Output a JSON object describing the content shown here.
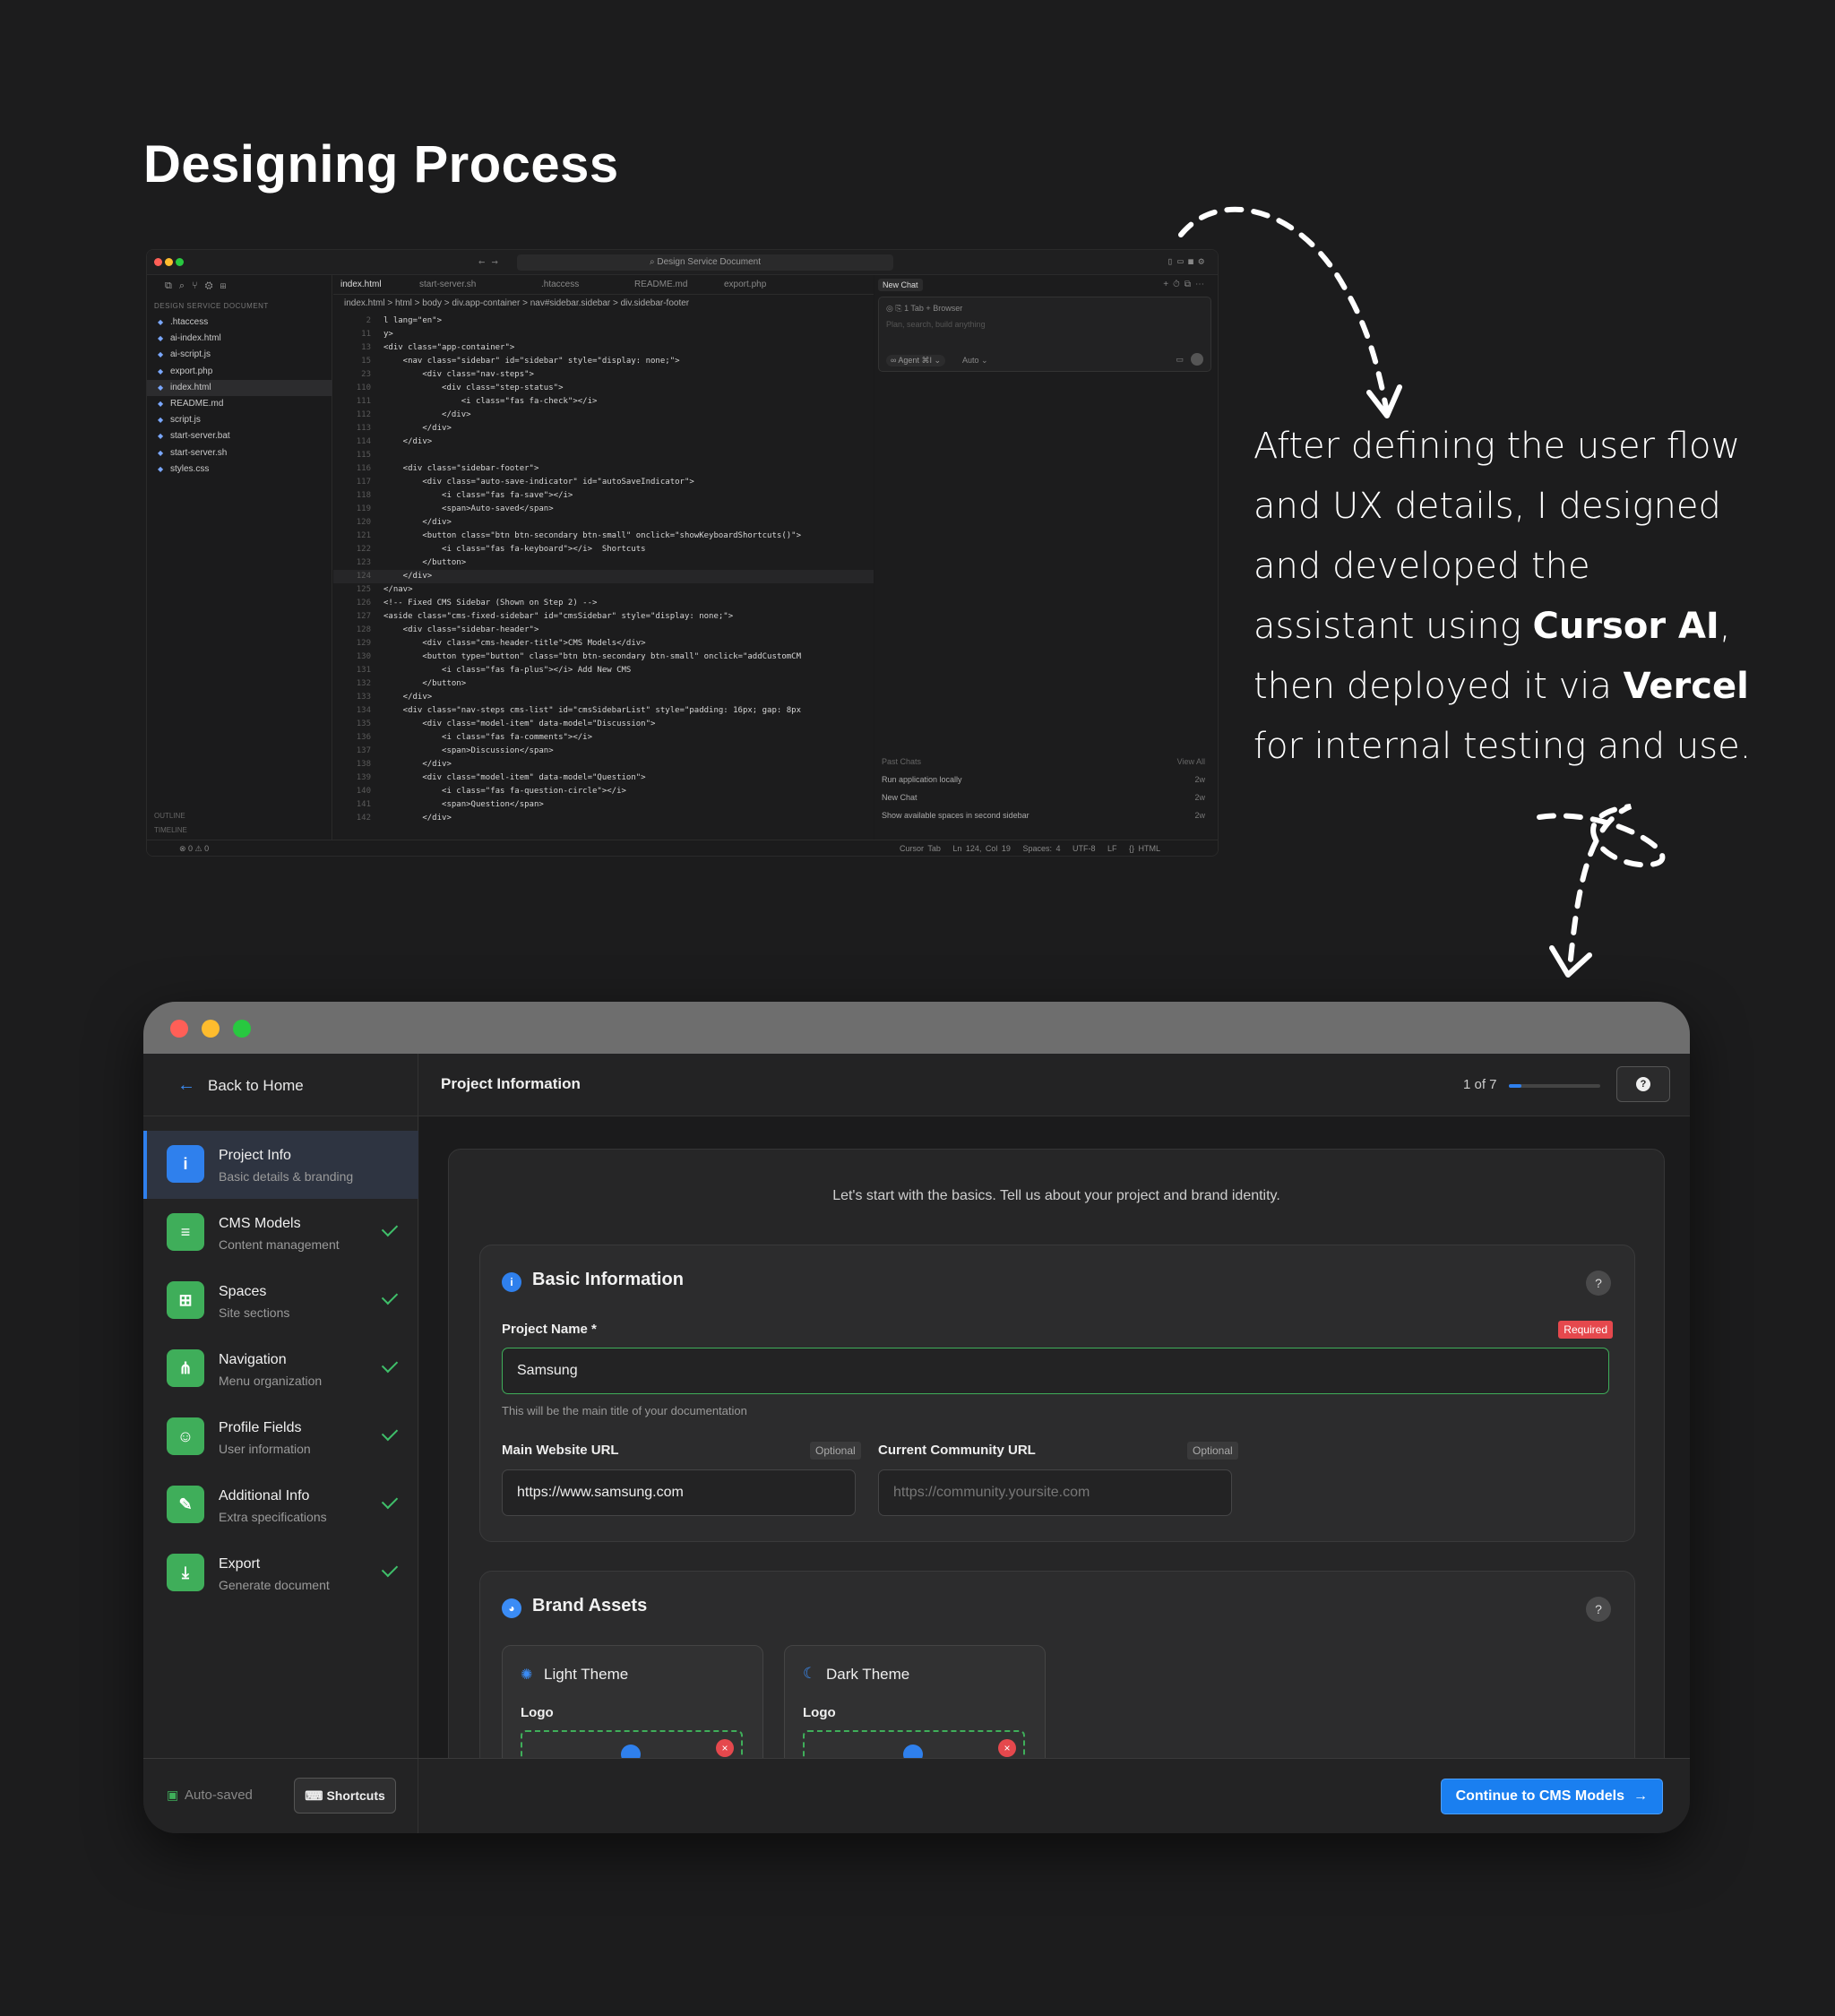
{
  "page": {
    "title": "Designing Process"
  },
  "ide": {
    "search_title": "Design Service Document",
    "explorer_header": "DESIGN SERVICE DOCUMENT",
    "files": [
      ".htaccess",
      "ai-index.html",
      "ai-script.js",
      "export.php",
      "index.html",
      "README.md",
      "script.js",
      "start-server.bat",
      "start-server.sh",
      "styles.css"
    ],
    "outline": "OUTLINE",
    "timeline": "TIMELINE",
    "tabs": [
      "index.html",
      "start-server.sh",
      ".htaccess",
      "README.md",
      "export.php"
    ],
    "breadcrumb": "index.html > html > body > div.app-container > nav#sidebar.sidebar > div.sidebar-footer",
    "line_numbers": [
      "2",
      "11",
      "13",
      "15",
      "23",
      "110",
      "111",
      "112",
      "113",
      "114",
      "115",
      "116",
      "117",
      "118",
      "119",
      "120",
      "121",
      "122",
      "123",
      "124",
      "125",
      "126",
      "127",
      "128",
      "129",
      "130",
      "131",
      "132",
      "133",
      "134",
      "135",
      "136",
      "137",
      "138",
      "139",
      "140",
      "141",
      "142"
    ],
    "code_lines": [
      "l lang=\"en\">",
      "y>",
      "<div class=\"app-container\">",
      "    <nav class=\"sidebar\" id=\"sidebar\" style=\"display: none;\">",
      "        <div class=\"nav-steps\">",
      "            <div class=\"step-status\">",
      "                <i class=\"fas fa-check\"></i>",
      "            </div>",
      "        </div>",
      "    </div>",
      "",
      "    <div class=\"sidebar-footer\">",
      "        <div class=\"auto-save-indicator\" id=\"autoSaveIndicator\">",
      "            <i class=\"fas fa-save\"></i>",
      "            <span>Auto-saved</span>",
      "        </div>",
      "        <button class=\"btn btn-secondary btn-small\" onclick=\"showKeyboardShortcuts()\">",
      "            <i class=\"fas fa-keyboard\"></i>  Shortcuts",
      "        </button>",
      "    </div>",
      "</nav>",
      "<!-- Fixed CMS Sidebar (Shown on Step 2) -->",
      "<aside class=\"cms-fixed-sidebar\" id=\"cmsSidebar\" style=\"display: none;\">",
      "    <div class=\"sidebar-header\">",
      "        <div class=\"cms-header-title\">CMS Models</div>",
      "        <button type=\"button\" class=\"btn btn-secondary btn-small\" onclick=\"addCustomCM",
      "            <i class=\"fas fa-plus\"></i> Add New CMS",
      "        </button>",
      "    </div>",
      "    <div class=\"nav-steps cms-list\" id=\"cmsSidebarList\" style=\"padding: 16px; gap: 8px",
      "        <div class=\"model-item\" data-model=\"Discussion\">",
      "            <i class=\"fas fa-comments\"></i>",
      "            <span>Discussion</span>",
      "        </div>",
      "        <div class=\"model-item\" data-model=\"Question\">",
      "            <i class=\"fas fa-question-circle\"></i>",
      "            <span>Question</span>",
      "        </div>"
    ],
    "chat": {
      "tab": "New Chat",
      "context_tab": "1 Tab",
      "browser": "Browser",
      "placeholder": "Plan, search, build anything",
      "agent": "Agent",
      "agent_shortcut": "⌘I",
      "auto": "Auto",
      "past_chats": "Past Chats",
      "view_all": "View All",
      "history": [
        {
          "title": "Run application locally",
          "age": "2w"
        },
        {
          "title": "New Chat",
          "age": "2w"
        },
        {
          "title": "Show available spaces in second sidebar",
          "age": "2w"
        }
      ]
    },
    "status": {
      "left": "⊗ 0 ⚠ 0",
      "cursor_tab": "Cursor Tab",
      "position": "Ln 124, Col 19",
      "spaces": "Spaces: 4",
      "encoding": "UTF-8",
      "eol": "LF",
      "language": "{} HTML"
    }
  },
  "description": {
    "part1": "After defining the user flow and UX details, I designed and developed the assistant using ",
    "tool1": "Cursor AI",
    "part2": ", then deployed it via ",
    "tool2": "Vercel",
    "part3": " for internal testing and use."
  },
  "app": {
    "back_label": "Back to Home",
    "header_title": "Project Information",
    "progress_text": "1 of 7",
    "progress_fraction": 0.14,
    "help_icon": "?",
    "steps": [
      {
        "title": "Project Info",
        "subtitle": "Basic details & branding",
        "icon": "info-icon",
        "color": "#2f80ed",
        "glyph": "i",
        "done": false,
        "active": true
      },
      {
        "title": "CMS Models",
        "subtitle": "Content management",
        "icon": "database-icon",
        "color": "#3fae5a",
        "glyph": "≡",
        "done": true,
        "active": false
      },
      {
        "title": "Spaces",
        "subtitle": "Site sections",
        "icon": "grid-icon",
        "color": "#3fae5a",
        "glyph": "⊞",
        "done": true,
        "active": false
      },
      {
        "title": "Navigation",
        "subtitle": "Menu organization",
        "icon": "sitemap-icon",
        "color": "#3fae5a",
        "glyph": "⋔",
        "done": true,
        "active": false
      },
      {
        "title": "Profile Fields",
        "subtitle": "User information",
        "icon": "user-gear-icon",
        "color": "#3fae5a",
        "glyph": "☺",
        "done": true,
        "active": false
      },
      {
        "title": "Additional Info",
        "subtitle": "Extra specifications",
        "icon": "edit-icon",
        "color": "#3fae5a",
        "glyph": "✎",
        "done": true,
        "active": false
      },
      {
        "title": "Export",
        "subtitle": "Generate document",
        "icon": "download-icon",
        "color": "#3fae5a",
        "glyph": "⤓",
        "done": true,
        "active": false
      }
    ],
    "intro": "Let's start with the basics. Tell us about your project and brand identity.",
    "basic": {
      "title": "Basic Information",
      "project_name_label": "Project Name *",
      "required_badge": "Required",
      "project_name_value": "Samsung",
      "project_name_hint": "This will be the main title of your documentation",
      "main_url_label": "Main Website URL",
      "optional": "Optional",
      "main_url_value": "https://www.samsung.com",
      "community_url_label": "Current Community URL",
      "community_url_placeholder": "https://community.yoursite.com"
    },
    "brand": {
      "title": "Brand Assets",
      "light_theme": "Light Theme",
      "dark_theme": "Dark Theme",
      "logo": "Logo"
    },
    "footer": {
      "autosaved": "Auto-saved",
      "shortcuts": "Shortcuts",
      "continue": "Continue to CMS Models"
    },
    "colors": {
      "accent": "#1a7ff0",
      "success": "#3fae5a",
      "danger": "#e5484d"
    }
  }
}
